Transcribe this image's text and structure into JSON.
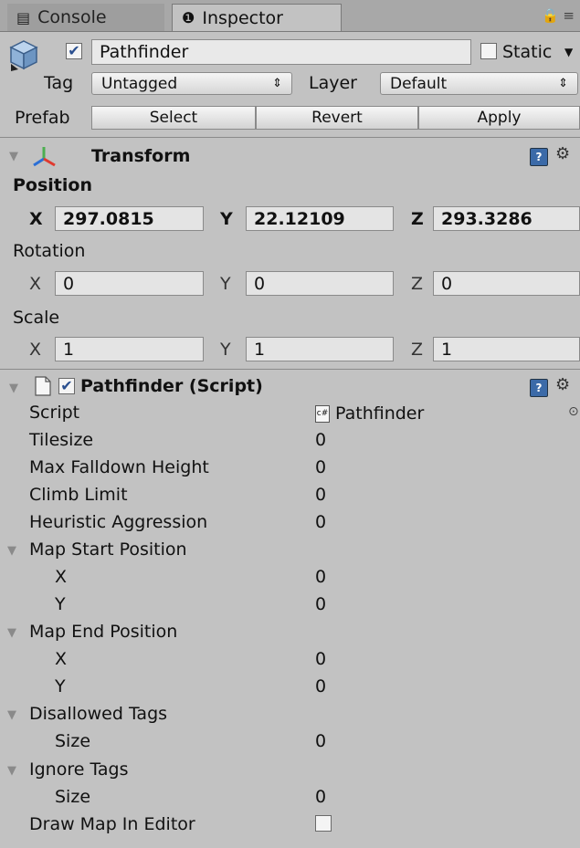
{
  "tabs": [
    {
      "label": "Console",
      "icon": "console-icon"
    },
    {
      "label": "Inspector",
      "icon": "info-icon"
    }
  ],
  "object": {
    "active": true,
    "name": "Pathfinder",
    "static_label": "Static",
    "static": false,
    "tag_label": "Tag",
    "tag_value": "Untagged",
    "layer_label": "Layer",
    "layer_value": "Default"
  },
  "prefab": {
    "label": "Prefab",
    "select": "Select",
    "revert": "Revert",
    "apply": "Apply"
  },
  "transform": {
    "title": "Transform",
    "position_label": "Position",
    "position": {
      "x_label": "X",
      "x": "297.0815",
      "y_label": "Y",
      "y": "22.12109",
      "z_label": "Z",
      "z": "293.3286"
    },
    "rotation_label": "Rotation",
    "rotation": {
      "x_label": "X",
      "x": "0",
      "y_label": "Y",
      "y": "0",
      "z_label": "Z",
      "z": "0"
    },
    "scale_label": "Scale",
    "scale": {
      "x_label": "X",
      "x": "1",
      "y_label": "Y",
      "y": "1",
      "z_label": "Z",
      "z": "1"
    }
  },
  "script": {
    "title": "Pathfinder (Script)",
    "enabled": true,
    "rows": {
      "script": {
        "label": "Script",
        "value": "Pathfinder"
      },
      "tilesize": {
        "label": "Tilesize",
        "value": "0"
      },
      "max_falldown": {
        "label": "Max Falldown Height",
        "value": "0"
      },
      "climb_limit": {
        "label": "Climb Limit",
        "value": "0"
      },
      "heuristic": {
        "label": "Heuristic Aggression",
        "value": "0"
      },
      "map_start": {
        "label": "Map Start Position"
      },
      "map_start_x": {
        "label": "X",
        "value": "0"
      },
      "map_start_y": {
        "label": "Y",
        "value": "0"
      },
      "map_end": {
        "label": "Map End Position"
      },
      "map_end_x": {
        "label": "X",
        "value": "0"
      },
      "map_end_y": {
        "label": "Y",
        "value": "0"
      },
      "disallowed": {
        "label": "Disallowed Tags"
      },
      "disallowed_size": {
        "label": "Size",
        "value": "0"
      },
      "ignore": {
        "label": "Ignore Tags"
      },
      "ignore_size": {
        "label": "Size",
        "value": "0"
      },
      "draw_map": {
        "label": "Draw Map In Editor",
        "checked": false
      }
    }
  },
  "colors": {
    "panel_bg": "#c2c2c2",
    "field_bg": "#e4e4e4",
    "checkbox_check": "#2a4f8f"
  }
}
